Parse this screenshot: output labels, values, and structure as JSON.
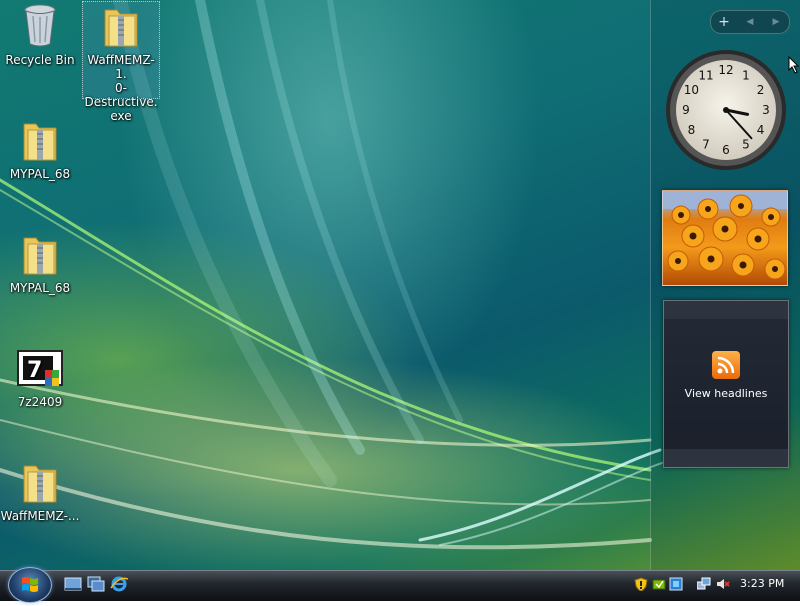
{
  "desktop": {
    "icons": [
      {
        "label": "Recycle Bin",
        "icon": "recycle-bin-icon"
      },
      {
        "label": "WaffMEMZ-1.0-Destructive.exe",
        "label_lines": [
          "WaffMEMZ-1.",
          "0-Destructive.",
          "exe"
        ],
        "icon": "zip-folder-icon",
        "selected": true
      },
      {
        "label": "MYPAL_68",
        "icon": "zip-folder-icon"
      },
      {
        "label": "MYPAL_68",
        "icon": "zip-folder-icon"
      },
      {
        "label": "7z2409",
        "icon": "7zip-installer-icon"
      },
      {
        "label": "WaffMEMZ-...",
        "icon": "zip-folder-icon"
      }
    ]
  },
  "sidebar": {
    "controls": [
      "+",
      "◀",
      "▶"
    ],
    "clock": {
      "hour": 3,
      "minute": 23,
      "numbers": [
        "12",
        "1",
        "2",
        "3",
        "4",
        "5",
        "6",
        "7",
        "8",
        "9",
        "10",
        "11"
      ]
    },
    "feed": {
      "label": "View headlines",
      "icon": "rss-icon"
    }
  },
  "taskbar": {
    "time": "3:23 PM",
    "quick_launch": [
      "show-desktop-icon",
      "switch-windows-icon",
      "internet-explorer-icon"
    ],
    "tray": [
      "security-shield-icon",
      "windows-update-icon",
      "tray-app-icon",
      "network-icon",
      "volume-muted-icon"
    ]
  },
  "colors": {
    "accent": "#0f6d74",
    "taskbar": "#1a1f26"
  }
}
